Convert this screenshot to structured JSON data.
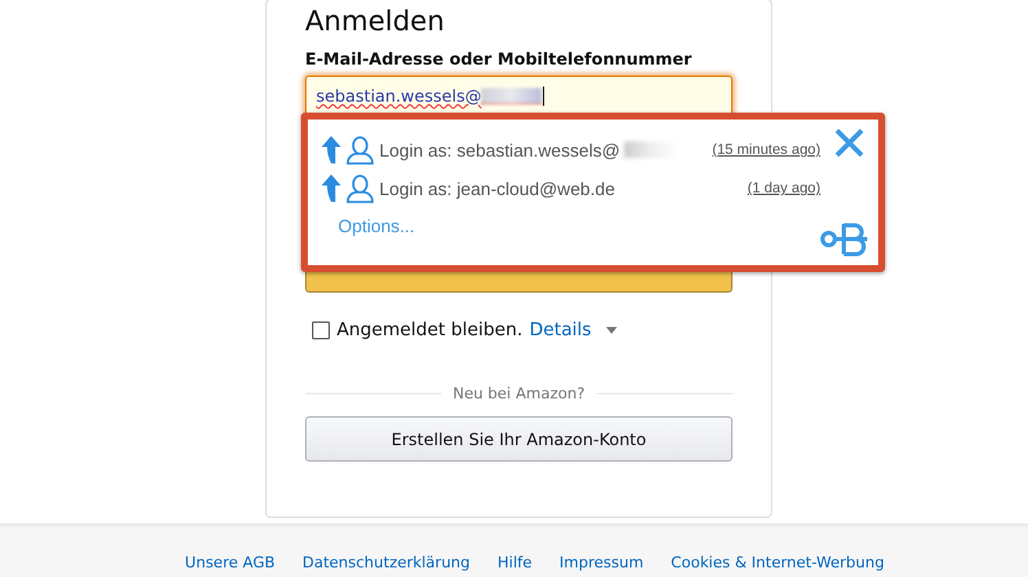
{
  "heading": "Anmelden",
  "email_label": "E-Mail-Adresse oder Mobiltelefonnummer",
  "email_field": {
    "value": "sebastian.wessels@"
  },
  "popup": {
    "accounts": [
      {
        "label": "Login as: sebastian.wessels@",
        "redacted": true,
        "time": "(15 minutes ago)"
      },
      {
        "label": "Login as: jean-cloud@web.de",
        "redacted": false,
        "time": "(1 day ago)"
      }
    ],
    "options": "Options..."
  },
  "remember": {
    "checked": false,
    "label": "Angemeldet bleiben.",
    "details": "Details"
  },
  "divider_text": "Neu bei Amazon?",
  "create_button": "Erstellen Sie Ihr Amazon-Konto",
  "footer_links": [
    "Unsere AGB",
    "Datenschutzerklärung",
    "Hilfe",
    "Impressum",
    "Cookies & Internet-Werbung"
  ]
}
